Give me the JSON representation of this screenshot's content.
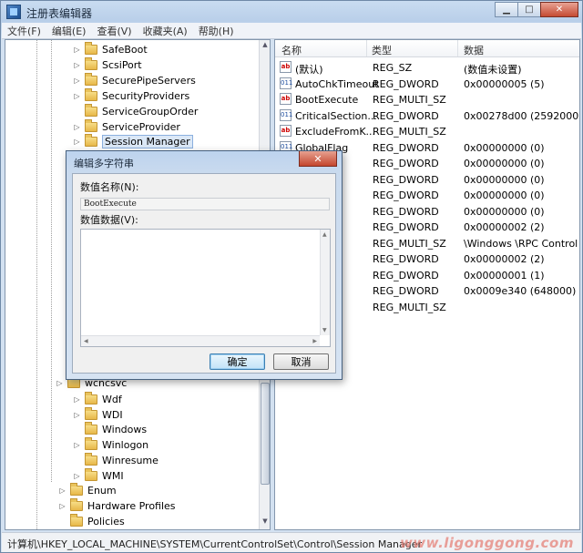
{
  "window": {
    "title": "注册表编辑器",
    "min_glyph": "▁",
    "max_glyph": "□",
    "close_glyph": "✕"
  },
  "menu": [
    {
      "label": "文件(F)"
    },
    {
      "label": "编辑(E)"
    },
    {
      "label": "查看(V)"
    },
    {
      "label": "收藏夹(A)"
    },
    {
      "label": "帮助(H)"
    }
  ],
  "tree": {
    "items": [
      {
        "label": "SafeBoot",
        "expander": "▷",
        "level": 2
      },
      {
        "label": "ScsiPort",
        "expander": "▷",
        "level": 2
      },
      {
        "label": "SecurePipeServers",
        "expander": "▷",
        "level": 2
      },
      {
        "label": "SecurityProviders",
        "expander": "▷",
        "level": 2
      },
      {
        "label": "ServiceGroupOrder",
        "expander": "",
        "level": 2
      },
      {
        "label": "ServiceProvider",
        "expander": "▷",
        "level": 2
      },
      {
        "label": "Session Manager",
        "expander": "▷",
        "level": 2,
        "selected": true
      },
      {
        "label": "Wdf",
        "expander": "▷",
        "level": 2
      },
      {
        "label": "WDI",
        "expander": "▷",
        "level": 2
      },
      {
        "label": "Windows",
        "expander": "",
        "level": 2
      },
      {
        "label": "Winlogon",
        "expander": "▷",
        "level": 2
      },
      {
        "label": "Winresume",
        "expander": "",
        "level": 2
      },
      {
        "label": "WMI",
        "expander": "▷",
        "level": 2
      },
      {
        "label": "Enum",
        "expander": "▷",
        "level": 1
      },
      {
        "label": "Hardware Profiles",
        "expander": "▷",
        "level": 1
      },
      {
        "label": "Policies",
        "expander": "",
        "level": 1
      }
    ],
    "partial_label": "wcncsvc"
  },
  "list": {
    "columns": {
      "name": "名称",
      "type": "类型",
      "data": "数据"
    },
    "rows": [
      {
        "name": "(默认)",
        "type": "REG_SZ",
        "data": "(数值未设置)",
        "icon": "sz"
      },
      {
        "name": "AutoChkTimeout",
        "type": "REG_DWORD",
        "data": "0x00000005 (5)",
        "icon": "bin"
      },
      {
        "name": "BootExecute",
        "type": "REG_MULTI_SZ",
        "data": "",
        "icon": "sz"
      },
      {
        "name": "CriticalSection...",
        "type": "REG_DWORD",
        "data": "0x00278d00 (2592000)",
        "icon": "bin"
      },
      {
        "name": "ExcludeFromK...",
        "type": "REG_MULTI_SZ",
        "data": "",
        "icon": "sz"
      },
      {
        "name": "GlobalFlag",
        "type": "REG_DWORD",
        "data": "0x00000000 (0)",
        "icon": "bin"
      },
      {
        "name": "mm",
        "type": "REG_DWORD",
        "data": "0x00000000 (0)",
        "icon": "bin"
      },
      {
        "name": "mm",
        "type": "REG_DWORD",
        "data": "0x00000000 (0)",
        "icon": "bin"
      },
      {
        "name": "ent",
        "type": "REG_DWORD",
        "data": "0x00000000 (0)",
        "icon": "bin"
      },
      {
        "name": "ent",
        "type": "REG_DWORD",
        "data": "0x00000000 (0)",
        "icon": "bin"
      },
      {
        "name": "niti",
        "type": "REG_DWORD",
        "data": "0x00000002 (2)",
        "icon": "bin"
      },
      {
        "name": "ctor",
        "type": "REG_MULTI_SZ",
        "data": "\\Windows \\RPC Control",
        "icon": "sz"
      },
      {
        "name": "ont",
        "type": "REG_DWORD",
        "data": "0x00000002 (2)",
        "icon": "bin"
      },
      {
        "name": "Mode",
        "type": "REG_DWORD",
        "data": "0x00000001 (1)",
        "icon": "bin"
      },
      {
        "name": "me",
        "type": "REG_DWORD",
        "data": "0x0009e340 (648000)",
        "icon": "bin"
      },
      {
        "name": "te",
        "type": "REG_MULTI_SZ",
        "data": "",
        "icon": "sz"
      }
    ]
  },
  "status": {
    "path": "计算机\\HKEY_LOCAL_MACHINE\\SYSTEM\\CurrentControlSet\\Control\\Session Manager",
    "watermark": "www.ligonggong.com"
  },
  "dialog": {
    "title": "编辑多字符串",
    "close_glyph": "✕",
    "name_label": "数值名称(N):",
    "name_value": "BootExecute",
    "data_label": "数值数据(V):",
    "data_value": "",
    "ok_label": "确定",
    "cancel_label": "取消"
  },
  "icons": {
    "string_value": "ab",
    "binary_value": "011"
  }
}
